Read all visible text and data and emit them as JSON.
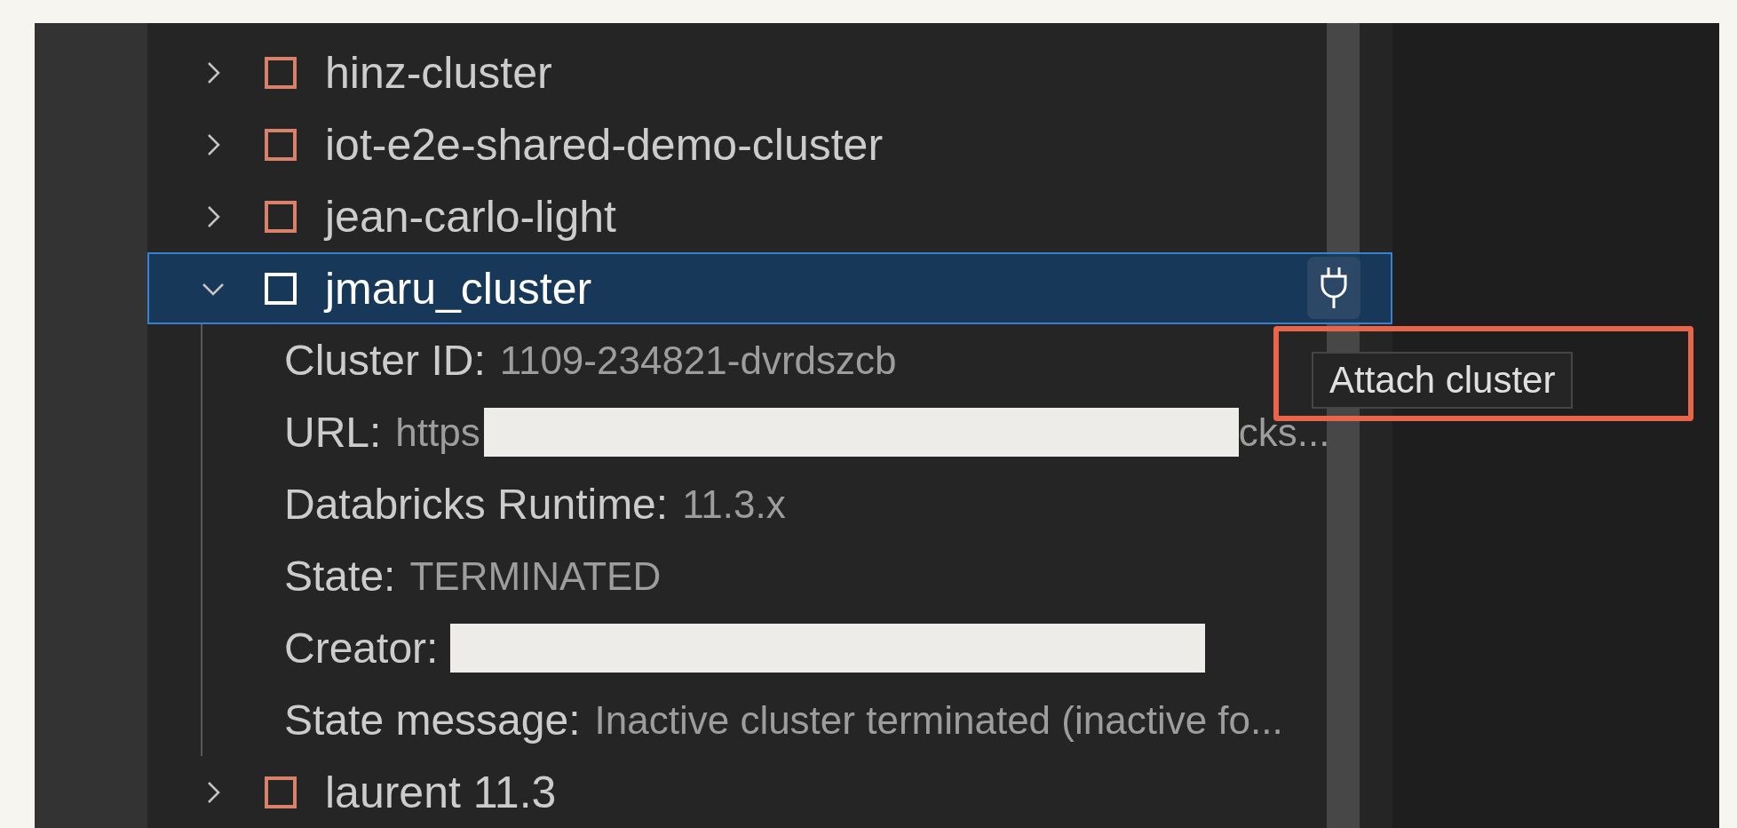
{
  "clusters": [
    {
      "name": "hinz-cluster",
      "expanded": false,
      "selected": false
    },
    {
      "name": "iot-e2e-shared-demo-cluster",
      "expanded": false,
      "selected": false
    },
    {
      "name": "jean-carlo-light",
      "expanded": false,
      "selected": false
    },
    {
      "name": "jmaru_cluster",
      "expanded": true,
      "selected": true,
      "details": [
        {
          "label": "Cluster ID:",
          "value": "1109-234821-dvrdszcb",
          "redacted": false
        },
        {
          "label": "URL:",
          "value": "https",
          "redacted": true,
          "value_tail": "cks..."
        },
        {
          "label": "Databricks Runtime:",
          "value": "11.3.x",
          "redacted": false
        },
        {
          "label": "State:",
          "value": "TERMINATED",
          "redacted": false
        },
        {
          "label": "Creator:",
          "redacted": true
        },
        {
          "label": "State message:",
          "value": "Inactive cluster terminated (inactive fo...",
          "redacted": false
        }
      ]
    },
    {
      "name": "laurent 11.3",
      "expanded": false,
      "selected": false
    }
  ],
  "tooltip": {
    "text": "Attach cluster",
    "highlighted": true
  }
}
